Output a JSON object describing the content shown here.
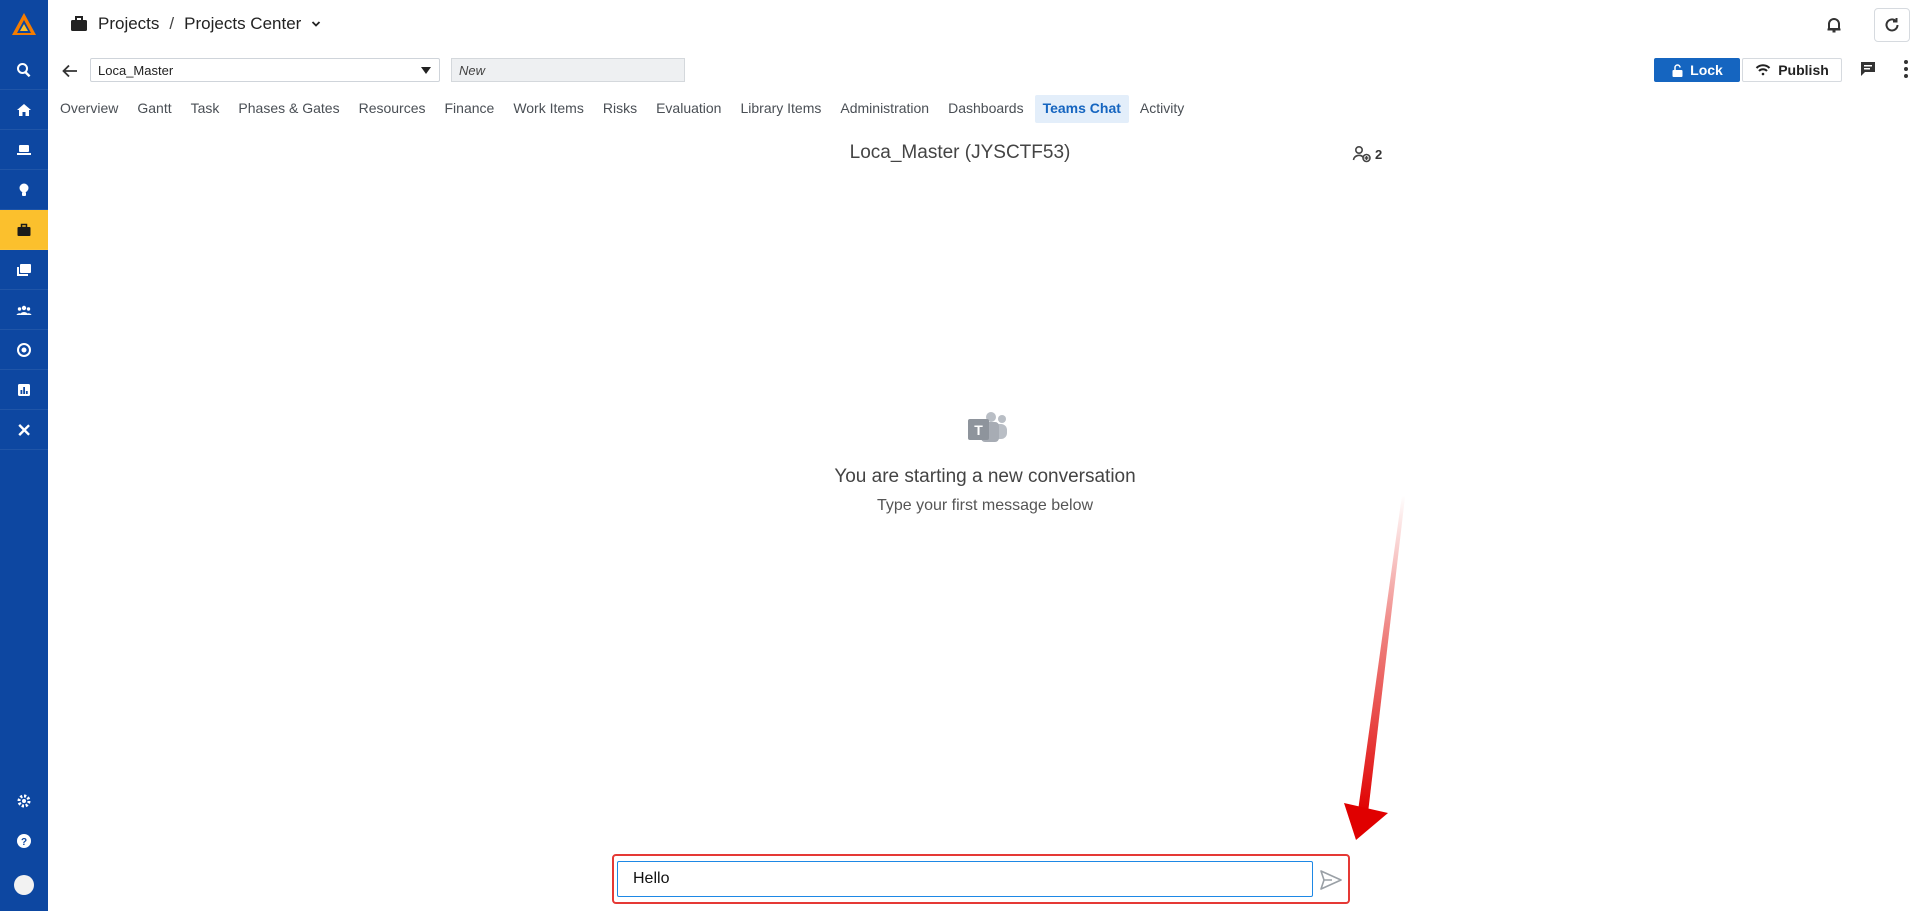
{
  "header": {
    "breadcrumb_root": "Projects",
    "breadcrumb_separator": "/",
    "breadcrumb_current": "Projects Center"
  },
  "project": {
    "selected": "Loca_Master",
    "status_value": "New",
    "lock_label": "Lock",
    "publish_label": "Publish"
  },
  "tabs": [
    {
      "label": "Overview"
    },
    {
      "label": "Gantt"
    },
    {
      "label": "Task"
    },
    {
      "label": "Phases & Gates"
    },
    {
      "label": "Resources"
    },
    {
      "label": "Finance"
    },
    {
      "label": "Work Items"
    },
    {
      "label": "Risks"
    },
    {
      "label": "Evaluation"
    },
    {
      "label": "Library Items"
    },
    {
      "label": "Administration"
    },
    {
      "label": "Dashboards"
    },
    {
      "label": "Teams Chat",
      "active": true
    },
    {
      "label": "Activity"
    }
  ],
  "chat": {
    "title": "Loca_Master (JYSCTF53)",
    "member_count": "2",
    "empty_title": "You are starting a new conversation",
    "empty_subtitle": "Type your first message below",
    "message_value": "Hello"
  },
  "sidebar": {
    "items": [
      {
        "icon": "search-icon"
      },
      {
        "icon": "home-icon"
      },
      {
        "icon": "laptop-icon"
      },
      {
        "icon": "lightbulb-icon"
      },
      {
        "icon": "briefcase-icon",
        "active": true
      },
      {
        "icon": "library-icon"
      },
      {
        "icon": "people-icon"
      },
      {
        "icon": "target-icon"
      },
      {
        "icon": "report-icon"
      },
      {
        "icon": "tools-icon"
      }
    ],
    "bottom_items": [
      {
        "icon": "gear-icon"
      },
      {
        "icon": "help-icon"
      },
      {
        "icon": "avatar-icon"
      }
    ]
  },
  "colors": {
    "rail": "#0d47a1",
    "rail_active": "#fbc02d",
    "accent": "#1565c0",
    "annotation": "#e53935"
  }
}
